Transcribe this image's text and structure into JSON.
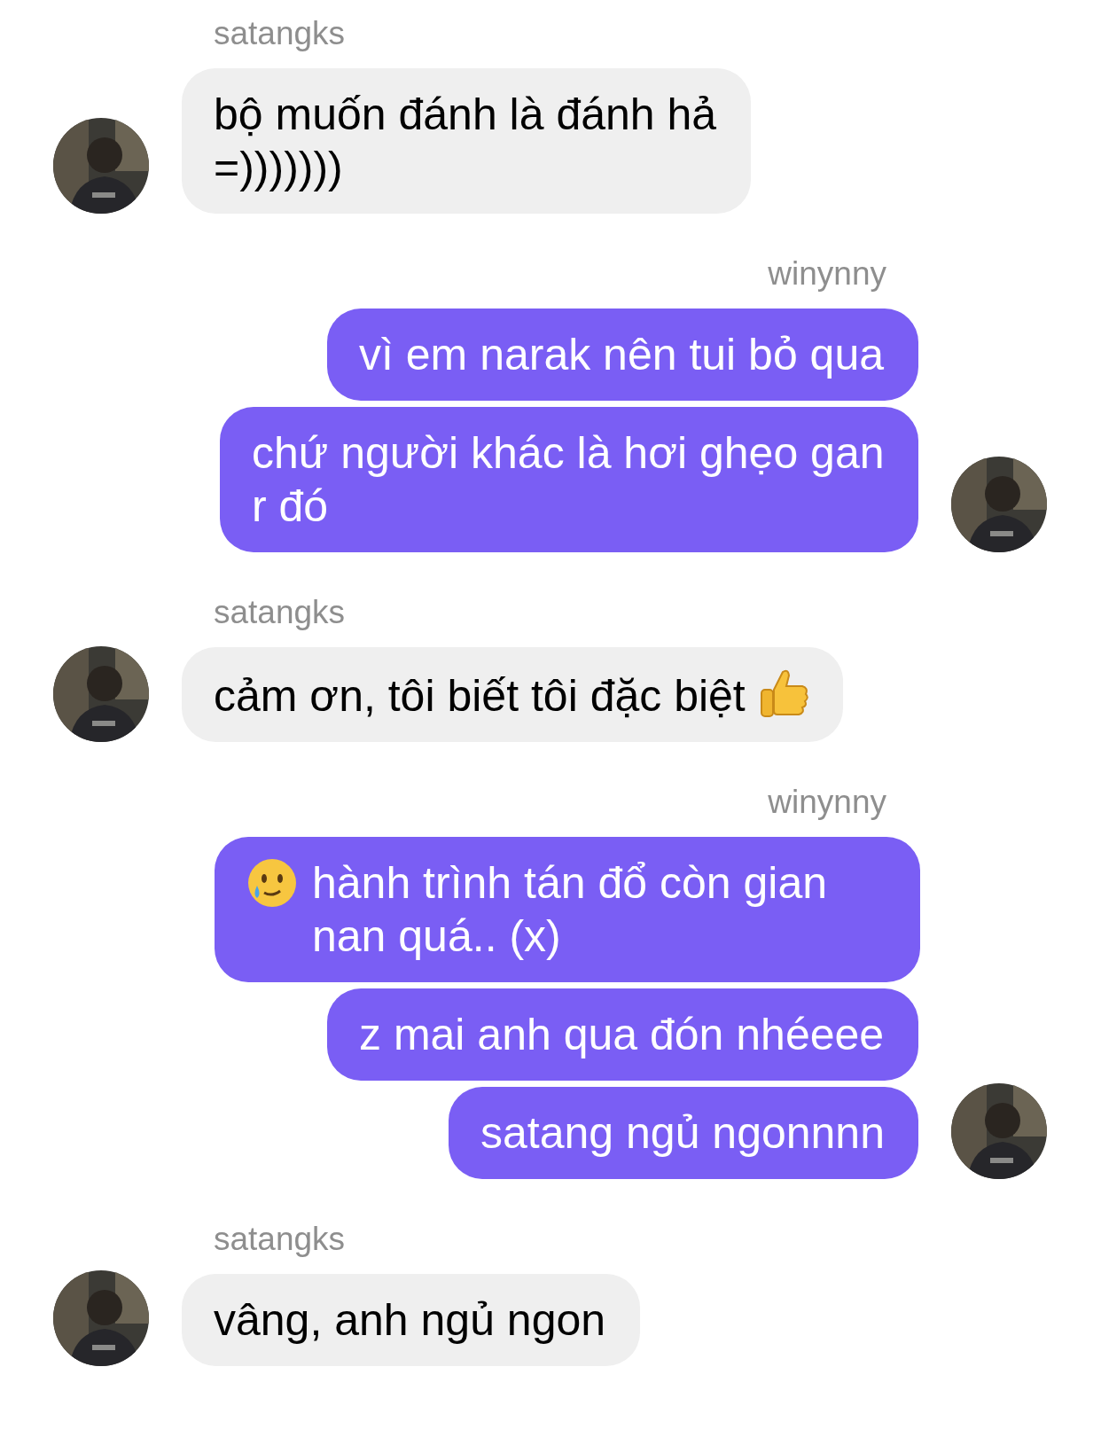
{
  "groups": [
    {
      "sender": "satangks",
      "kind": "incoming",
      "avatar": {
        "kind": "picture"
      },
      "messages": [
        {
          "parts": [
            {
              "kind": "text",
              "text": "bộ muốn đánh là đánh hả =)))))))"
            }
          ]
        }
      ]
    },
    {
      "sender": "winynny",
      "kind": "outgoing",
      "avatar": {
        "kind": "picture"
      },
      "messages": [
        {
          "parts": [
            {
              "kind": "text",
              "text": "vì em narak nên tui bỏ qua"
            }
          ]
        },
        {
          "parts": [
            {
              "kind": "text",
              "text": "chứ người khác là hơi ghẹo gan r đó"
            }
          ]
        }
      ]
    },
    {
      "sender": "satangks",
      "kind": "incoming",
      "avatar": {
        "kind": "picture"
      },
      "messages": [
        {
          "parts": [
            {
              "kind": "text",
              "text": "cảm ơn, tôi biết tôi đặc biệt"
            },
            {
              "kind": "thumbs-up"
            }
          ]
        }
      ]
    },
    {
      "sender": "winynny",
      "kind": "outgoing",
      "avatar": {
        "kind": "picture"
      },
      "messages": [
        {
          "parts": [
            {
              "kind": "tear-smile"
            },
            {
              "kind": "text",
              "text": "hành trình tán đổ còn gian nan quá.. (x)"
            }
          ]
        },
        {
          "parts": [
            {
              "kind": "text",
              "text": "z mai anh qua đón nhéeee"
            }
          ]
        },
        {
          "parts": [
            {
              "kind": "text",
              "text": "satang ngủ ngonnnn"
            }
          ]
        }
      ]
    },
    {
      "sender": "satangks",
      "kind": "incoming",
      "avatar": {
        "kind": "picture"
      },
      "messages": [
        {
          "parts": [
            {
              "kind": "text",
              "text": "vâng, anh ngủ ngon"
            }
          ]
        }
      ]
    }
  ]
}
